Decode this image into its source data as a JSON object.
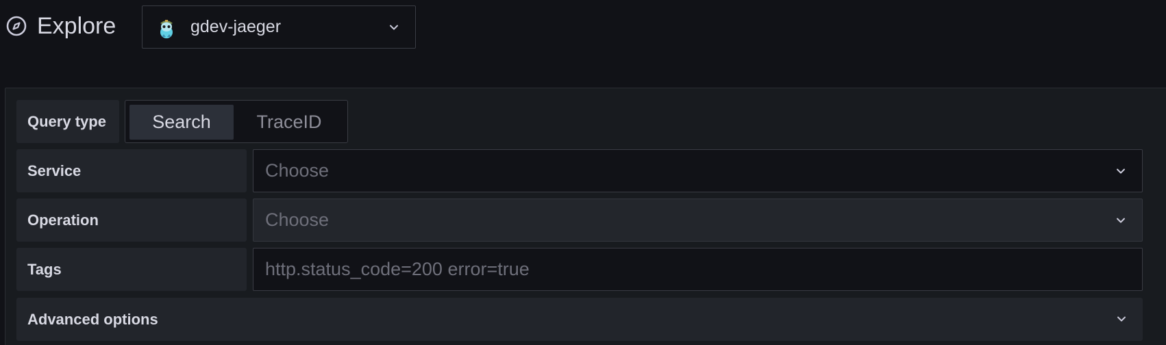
{
  "header": {
    "title": "Explore",
    "icon": "compass-icon",
    "datasource": {
      "name": "gdev-jaeger",
      "logo": "jaeger-logo-icon"
    }
  },
  "query": {
    "query_type": {
      "label": "Query type",
      "options": [
        "Search",
        "TraceID"
      ],
      "selected": "Search"
    },
    "service": {
      "label": "Service",
      "placeholder": "Choose"
    },
    "operation": {
      "label": "Operation",
      "placeholder": "Choose",
      "disabled": true
    },
    "tags": {
      "label": "Tags",
      "placeholder": "http.status_code=200 error=true"
    },
    "advanced": {
      "label": "Advanced options"
    }
  },
  "colors": {
    "background": "#111217",
    "panel": "#181b1f",
    "label_bg": "#22252b",
    "text": "#d8d9e3",
    "placeholder": "#6e6f7a"
  }
}
